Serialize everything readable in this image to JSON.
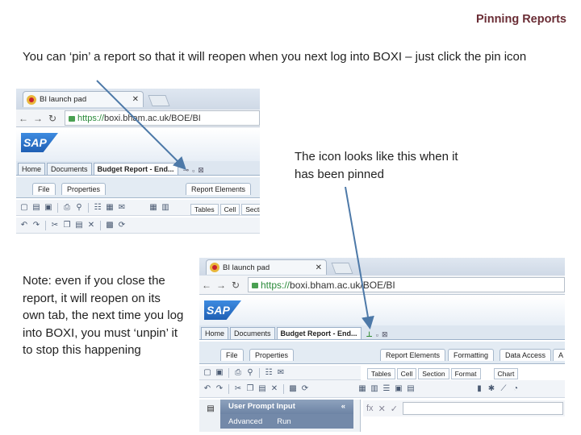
{
  "slide": {
    "title": "Pinning Reports",
    "intro": "You can ‘pin’ a report so that it will reopen when you next log into BOXI – just click the pin icon",
    "pinned_note": "The icon looks like this when it has been pinned",
    "note": "Note: even if you close the report, it will reopen on its own tab, the next time you log into BOXI, you must ‘unpin’ it to stop this happening"
  },
  "screenshot1": {
    "tab_title": "BI launch pad",
    "url_https": "https://",
    "url_rest": "boxi.bham.ac.uk/BOE/BI",
    "logo": "SAP",
    "bi_tabs": [
      "Home",
      "Documents",
      "Budget Report - End..."
    ],
    "ribbon_tabs": [
      "File",
      "Properties",
      "Report Elements"
    ],
    "sub_tabs": [
      "Tables",
      "Cell",
      "Section"
    ],
    "pin_icon": "pin-unpinned",
    "icons": [
      "new-doc-icon",
      "open-icon",
      "save-icon",
      "print-icon",
      "find-icon",
      "undo-icon",
      "redo-icon",
      "cut-icon",
      "copy-icon",
      "paste-icon",
      "delete-icon",
      "track-icon",
      "refresh-icon"
    ]
  },
  "screenshot2": {
    "tab_title": "BI launch pad",
    "url_https": "https://",
    "url_rest": "boxi.bham.ac.uk/BOE/BI",
    "logo": "SAP",
    "bi_tabs": [
      "Home",
      "Documents",
      "Budget Report - End..."
    ],
    "ribbon_tabs": [
      "File",
      "Properties",
      "Report Elements",
      "Formatting",
      "Data Access",
      "A"
    ],
    "sub_tabs": [
      "Tables",
      "Cell",
      "Section",
      "Format",
      "Chart"
    ],
    "pin_icon": "pin-pinned",
    "panel_header": "User Prompt Input",
    "panel_buttons": [
      "Advanced",
      "Run"
    ],
    "formula_symbols": [
      "fx",
      "✕",
      "✓"
    ]
  },
  "colors": {
    "title": "#6a2d35",
    "arrow": "#4d79a8",
    "pin_green": "#2f8a2f"
  }
}
